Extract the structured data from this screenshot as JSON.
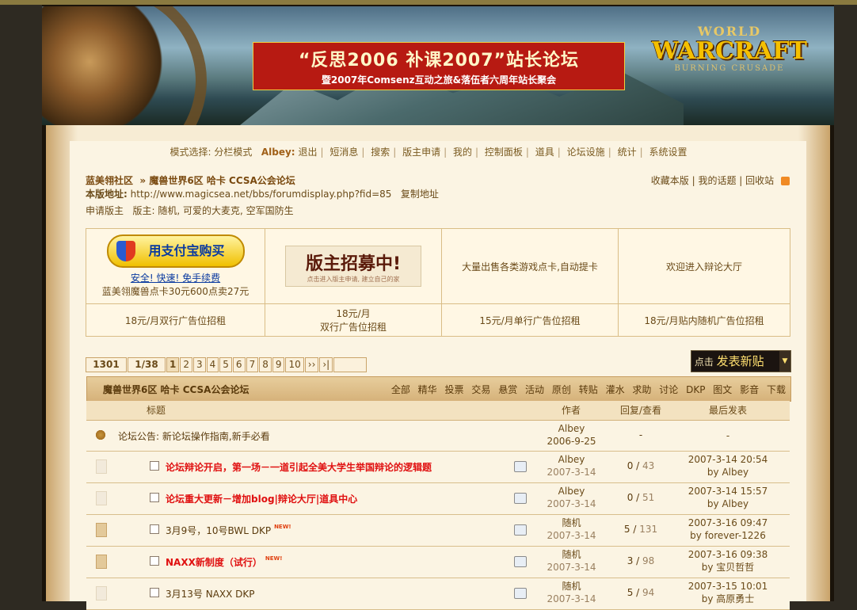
{
  "banner": {
    "promo_line1": "“反思2006 补课2007”站长论坛",
    "promo_line2": "暨2007年Comsenz互动之旅&落伍者六周年站长聚会",
    "logo_world": "WORLD",
    "logo_warcraft": "WARCRAFT",
    "logo_sub": "BURNING CRUSADE"
  },
  "modebar": {
    "mode_label": "模式选择:",
    "mode_value": "分栏模式",
    "user": "Albey:",
    "links": [
      "退出",
      "短消息",
      "搜索",
      "版主申请",
      "我的",
      "控制面板",
      "道具",
      "论坛设施",
      "统计",
      "系统设置"
    ]
  },
  "breadcrumb": {
    "site": "蓝美翎社区",
    "sep": "»",
    "forum": "魔兽世界6区 哈卡 CCSA公会论坛"
  },
  "address": {
    "label": "本版地址:",
    "url": "http://www.magicsea.net/bbs/forumdisplay.php?fid=85",
    "copy": "复制地址"
  },
  "moderators": {
    "apply": "申请版主",
    "label": "版主:",
    "names": "随机, 可爱的大麦克, 空军国防生"
  },
  "right_links": [
    "收藏本版",
    "我的话题",
    "回收站"
  ],
  "ads": {
    "alipay_btn": "用支付宝购买",
    "alipay_safe": "安全! 快速! 免手续费",
    "alipay_caption": "蓝美翎魔兽点卡30元600点卖27元",
    "recruit_title": "版主招募中!",
    "recruit_sub": "点击进入版主申请, 建立自己的家",
    "cell3": "大量出售各类游戏点卡,自动提卡",
    "cell4": "欢迎进入辩论大厅",
    "row2": [
      "18元/月双行广告位招租",
      "18元/月\n双行广告位招租",
      "15元/月单行广告位招租",
      "18元/月贴内随机广告位招租"
    ]
  },
  "pager": {
    "total": "1301",
    "pages": "1/38",
    "items": [
      "1",
      "2",
      "3",
      "4",
      "5",
      "6",
      "7",
      "8",
      "9",
      "10",
      "››",
      "›|"
    ],
    "current": "1"
  },
  "newpost": {
    "prefix": "点击",
    "label": "发表新贴"
  },
  "forum_header": {
    "name": "魔兽世界6区 哈卡 CCSA公会论坛",
    "filters": [
      "全部",
      "精华",
      "投票",
      "交易",
      "悬赏",
      "活动",
      "原创",
      "转贴",
      "灌水",
      "求助",
      "讨论",
      "DKP",
      "图文",
      "影音",
      "下载"
    ]
  },
  "columns": {
    "title": "标题",
    "author": "作者",
    "replies": "回复/查看",
    "last": "最后发表"
  },
  "announcement": {
    "label": "论坛公告:",
    "text": "新论坛操作指南,新手必看",
    "author": "Albey",
    "date": "2006-9-25",
    "replies": "-",
    "last": "-"
  },
  "threads": [
    {
      "title": "论坛辩论开启，第一场－一道引起全美大学生举国辩论的逻辑题",
      "red": true,
      "new": false,
      "author": "Albey",
      "date": "2007-3-14",
      "replies": "0",
      "views": "43",
      "last_time": "2007-3-14 20:54",
      "last_by": "by Albey"
    },
    {
      "title": "论坛重大更新－增加blog|辩论大厅|道具中心",
      "red": true,
      "new": false,
      "author": "Albey",
      "date": "2007-3-14",
      "replies": "0",
      "views": "51",
      "last_time": "2007-3-14 15:57",
      "last_by": "by Albey"
    },
    {
      "title": "3月9号，10号BWL DKP",
      "red": false,
      "new": true,
      "author": "随机",
      "date": "2007-3-14",
      "replies": "5",
      "views": "131",
      "last_time": "2007-3-16 09:47",
      "last_by": "by forever-1226"
    },
    {
      "title": "NAXX新制度（试行）",
      "red": true,
      "new": true,
      "author": "随机",
      "date": "2007-3-14",
      "replies": "3",
      "views": "98",
      "last_time": "2007-3-16 09:38",
      "last_by": "by 宝贝哲哲"
    },
    {
      "title": "3月13号 NAXX DKP",
      "red": false,
      "new": false,
      "author": "随机",
      "date": "2007-3-14",
      "replies": "5",
      "views": "94",
      "last_time": "2007-3-15 10:01",
      "last_by": "by 高原勇士"
    }
  ],
  "new_badge": "NEW!"
}
